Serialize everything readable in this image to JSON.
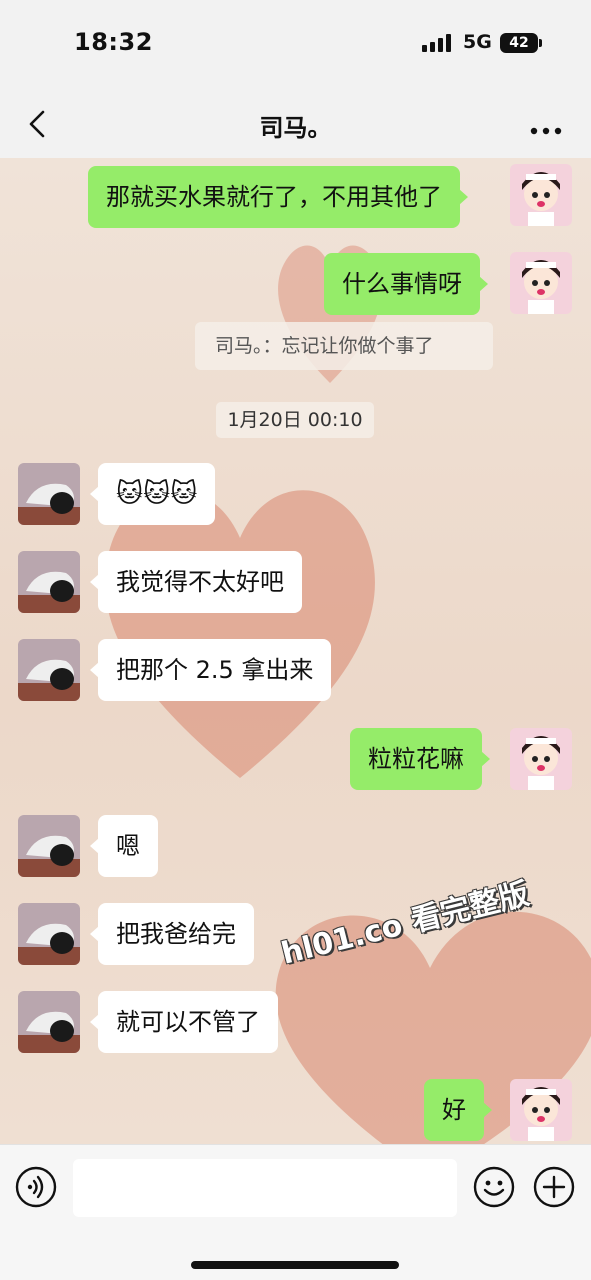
{
  "status_bar": {
    "time": "18:32",
    "network": "5G",
    "battery": "42"
  },
  "header": {
    "title": "司马。",
    "back_icon": "chevron-left-icon",
    "more_icon": "ellipsis-icon"
  },
  "messages": [
    {
      "from": "me",
      "text": "那就买水果就行了，不用其他了"
    },
    {
      "from": "me",
      "text": "什么事情呀"
    },
    {
      "from": "quote",
      "text": "司马。：忘记让你做个事了"
    },
    {
      "from": "system",
      "text": "1月20日 00:10"
    },
    {
      "from": "other",
      "text": "🐱🐱🐱"
    },
    {
      "from": "other",
      "text": "我觉得不太好吧"
    },
    {
      "from": "other",
      "text": "把那个 2.5 拿出来"
    },
    {
      "from": "me",
      "text": "粒粒花嘛"
    },
    {
      "from": "other",
      "text": "嗯"
    },
    {
      "from": "other",
      "text": "把我爸给完"
    },
    {
      "from": "other",
      "text": "就可以不管了"
    },
    {
      "from": "me",
      "text": "好"
    }
  ],
  "watermark": "hl01.co 看完整版",
  "input_bar": {
    "voice_icon": "voice-icon",
    "emoji_icon": "smile-icon",
    "plus_icon": "plus-circle-icon",
    "placeholder": ""
  },
  "colors": {
    "my_bubble": "#95ec69",
    "their_bubble": "#ffffff",
    "background": "#efe2d6"
  }
}
